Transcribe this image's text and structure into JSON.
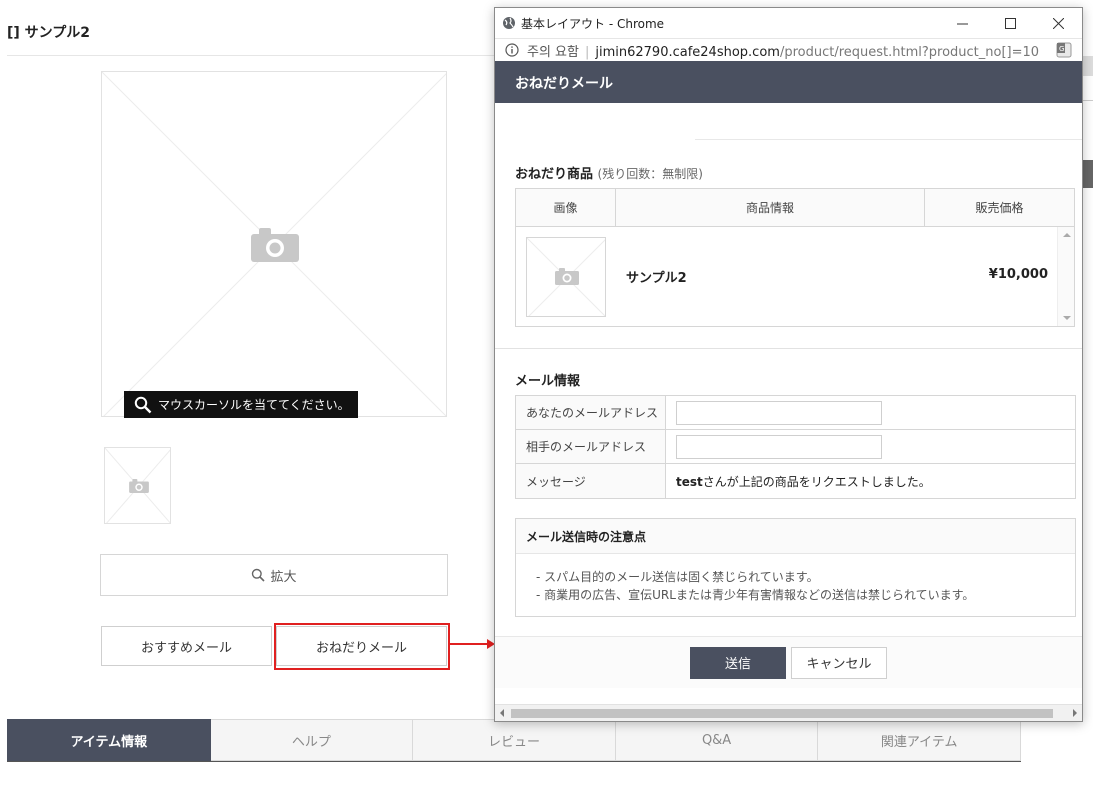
{
  "product_page": {
    "title": "[] サンプル2",
    "zoom_hint": "マウスカーソルを当ててください。",
    "zoom_button": "拡大",
    "recommend_mail_button": "おすすめメール",
    "request_mail_button": "おねだりメール",
    "tabs": [
      {
        "label": "アイテム情報",
        "active": true
      },
      {
        "label": "ヘルプ",
        "active": false
      },
      {
        "label": "レビュー",
        "active": false
      },
      {
        "label": "Q&A",
        "active": false
      },
      {
        "label": "関連アイテム",
        "active": false
      }
    ]
  },
  "window": {
    "title": "基本レイアウト - Chrome",
    "security_label": "주의 요함",
    "url_host": "jimin62790.cafe24shop.com",
    "url_path": "/product/request.html?product_no[]=10"
  },
  "popup": {
    "header": "おねだりメール",
    "product_section": {
      "title": "おねだり商品",
      "subtitle": "(残り回数：無制限)",
      "columns": [
        "画像",
        "商品情報",
        "販売価格"
      ],
      "item": {
        "name": "サンプル2",
        "price": "¥10,000"
      }
    },
    "mail_section": {
      "title": "メール情報",
      "rows": [
        {
          "label": "あなたのメールアドレス",
          "value": ""
        },
        {
          "label": "相手のメールアドレス",
          "value": ""
        },
        {
          "label": "メッセージ",
          "name": "test",
          "text": "さんが上記の商品をリクエストしました。"
        }
      ]
    },
    "notice": {
      "title": "メール送信時の注意点",
      "items": [
        "- スパム目的のメール送信は固く禁じられています。",
        "- 商業用の広告、宣伝URLまたは青少年有害情報などの送信は禁じられています。"
      ]
    },
    "send_button": "送信",
    "cancel_button": "キャンセル"
  },
  "colors": {
    "header_bg": "#4a5060",
    "highlight": "#e02020"
  }
}
